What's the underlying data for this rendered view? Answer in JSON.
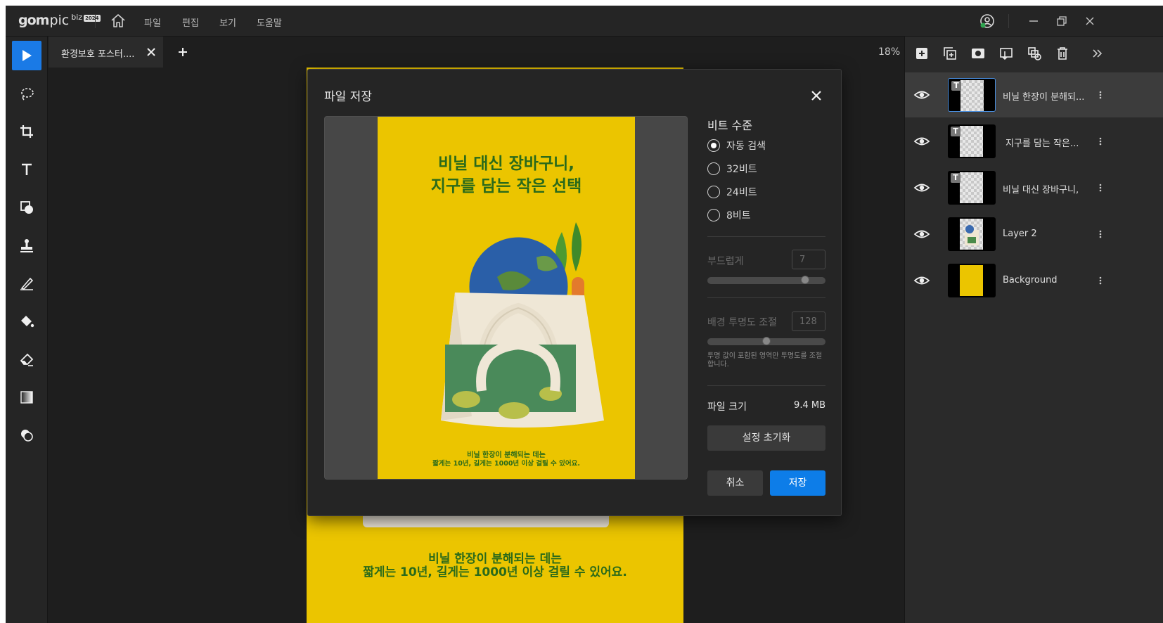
{
  "app": {
    "logo_gom": "gom",
    "logo_pic": "pic",
    "logo_biz": "biz",
    "logo_year": "2024",
    "menus": [
      "파일",
      "편집",
      "보기",
      "도움말"
    ]
  },
  "tabs": {
    "doc_title": "환경보호 포스터....",
    "zoom": "18%"
  },
  "canvas": {
    "caption_line1": "비닐 한장이 분해되는 데는",
    "caption_line2": "짧게는 10년, 길게는 1000년 이상 걸릴 수 있어요."
  },
  "layers": [
    {
      "name": "비닐 한장이 분해되...",
      "type": "text",
      "selected": true
    },
    {
      "name": "지구를 담는 작은...",
      "type": "text",
      "selected": false
    },
    {
      "name": "비닐 대신 장바구니,",
      "type": "text",
      "selected": false
    },
    {
      "name": "Layer 2",
      "type": "image",
      "selected": false
    },
    {
      "name": "Background",
      "type": "fill",
      "selected": false
    }
  ],
  "dialog": {
    "title": "파일 저장",
    "preview": {
      "headline_1": "비닐 대신 장바구니,",
      "headline_2": "지구를 담는 작은 선택",
      "caption_1": "비닐 한장이 분해되는 데는",
      "caption_2": "짧게는 10년, 길게는 1000년 이상 걸릴 수 있어요."
    },
    "bit_depth": {
      "heading": "비트 수준",
      "options": [
        "자동 검색",
        "32비트",
        "24비트",
        "8비트"
      ],
      "selected": "자동 검색"
    },
    "smooth": {
      "label": "부드럽게",
      "value": "7",
      "level_fraction": 0.85
    },
    "bg_opacity": {
      "label": "배경 투명도 조절",
      "value": "128",
      "level_fraction": 0.5,
      "hint": "투명 값이 포함된 영역만 투명도를 조절합니다."
    },
    "file_size": {
      "label": "파일 크기",
      "value": "9.4 MB"
    },
    "reset_label": "설정 초기화",
    "cancel_label": "취소",
    "save_label": "저장"
  },
  "colors": {
    "accent": "#0d7de8",
    "poster_yellow": "#ebc500",
    "poster_green": "#2a6a1a"
  }
}
